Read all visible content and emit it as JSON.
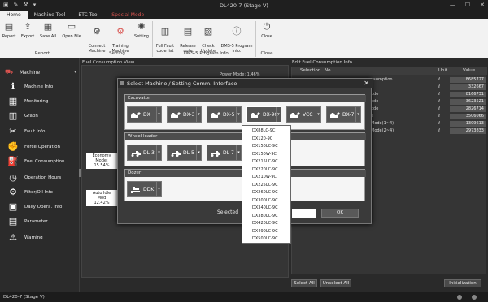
{
  "window": {
    "title": "DL420-7 (Stage V)"
  },
  "tabs": [
    {
      "label": "Home"
    },
    {
      "label": "Machine Tool"
    },
    {
      "label": "ETC Tool"
    },
    {
      "label": "Special Mode"
    }
  ],
  "ribbon": {
    "buttons": [
      {
        "label": "Report"
      },
      {
        "label": "Export"
      },
      {
        "label": "Save All"
      },
      {
        "label": "Open File"
      },
      {
        "label": "Connect\nMachine"
      },
      {
        "label": "Training\nMachine"
      },
      {
        "label": "Setting"
      },
      {
        "label": "Full Fault\ncode list"
      },
      {
        "label": "Release\nnote"
      },
      {
        "label": "Check\nUpdate"
      },
      {
        "label": "DMS-5 Program\ninfo."
      },
      {
        "label": "Close"
      }
    ],
    "groups": [
      {
        "label": "Report"
      },
      {
        "label": "Setting"
      },
      {
        "label": "DMS-5 Program Info."
      },
      {
        "label": "Close"
      }
    ]
  },
  "nav": {
    "machine_label": "Machine",
    "items": [
      {
        "label": "Machine Info",
        "icon": "info-icon"
      },
      {
        "label": "Monitoring",
        "icon": "monitor-icon"
      },
      {
        "label": "Graph",
        "icon": "graph-icon"
      },
      {
        "label": "Fault Info",
        "icon": "fault-icon"
      },
      {
        "label": "Force Operation",
        "icon": "force-icon"
      },
      {
        "label": "Fuel Consumption",
        "icon": "fuel-icon"
      },
      {
        "label": "Operation Hours",
        "icon": "clock-icon"
      },
      {
        "label": "Filter/Oil Info",
        "icon": "oil-icon"
      },
      {
        "label": "Daily Opera. Info",
        "icon": "calendar-icon"
      },
      {
        "label": "Parameter",
        "icon": "parameter-icon"
      },
      {
        "label": "Warning",
        "icon": "warning-icon"
      }
    ]
  },
  "main": {
    "title": "Fuel Consumption View",
    "power_mode": "Power Mode: 1.46%",
    "economy_mode": "Economy\nMode: 15.54%",
    "auto_idle": "Auto Idle Mod\n12.42%"
  },
  "right": {
    "title": "Edit Fuel Consumption Info",
    "headers": {
      "selection": "Selection",
      "no": "No",
      "unit": "Unit",
      "value": "Value"
    },
    "rows": [
      {
        "name": "nsumption",
        "unit": "ℓ",
        "value": "8685727"
      },
      {
        "name": "",
        "unit": "ℓ",
        "value": "332667"
      },
      {
        "name": "ode",
        "unit": "ℓ",
        "value": "8166731"
      },
      {
        "name": "ode",
        "unit": "ℓ",
        "value": "3623521"
      },
      {
        "name": "ode",
        "unit": "ℓ",
        "value": "2826714"
      },
      {
        "name": "e",
        "unit": "ℓ",
        "value": "3506066"
      },
      {
        "name": "Mode(1~4)",
        "unit": "ℓ",
        "value": "1309613"
      },
      {
        "name": "Mode(2~4)",
        "unit": "ℓ",
        "value": "2973833"
      }
    ],
    "select_all": "Select All",
    "unselect_all": "Unselect All",
    "initialization": "Initialization"
  },
  "status": {
    "text": "DL420-7 (Stage V)"
  },
  "dialog": {
    "title": "Select Machine / Setting Comm. Interface",
    "sections": {
      "excavator": "Excavator",
      "wheel_loader": "Wheel loader",
      "dozer": "Dozer"
    },
    "excavators": [
      "DX",
      "DX-3",
      "DX-5",
      "DX-9C",
      "VCC",
      "DX-7"
    ],
    "wheel_loaders": [
      "DL-3",
      "DL-5",
      "DL-7"
    ],
    "dozers": [
      "DDK"
    ],
    "selected_label": "Selected",
    "ok": "OK",
    "dropdown": [
      "DX88LC-9C",
      "DX120-9C",
      "DX150LC-9C",
      "DX150W-9C",
      "DX215LC-9C",
      "DX220LC-9C",
      "DX210W-9C",
      "DX225LC-9C",
      "DX260LC-9C",
      "DX300LC-9C",
      "DX340LC-9C",
      "DX380LC-9C",
      "DX420LC-9C",
      "DX490LC-9C",
      "DX500LC-9C"
    ]
  }
}
